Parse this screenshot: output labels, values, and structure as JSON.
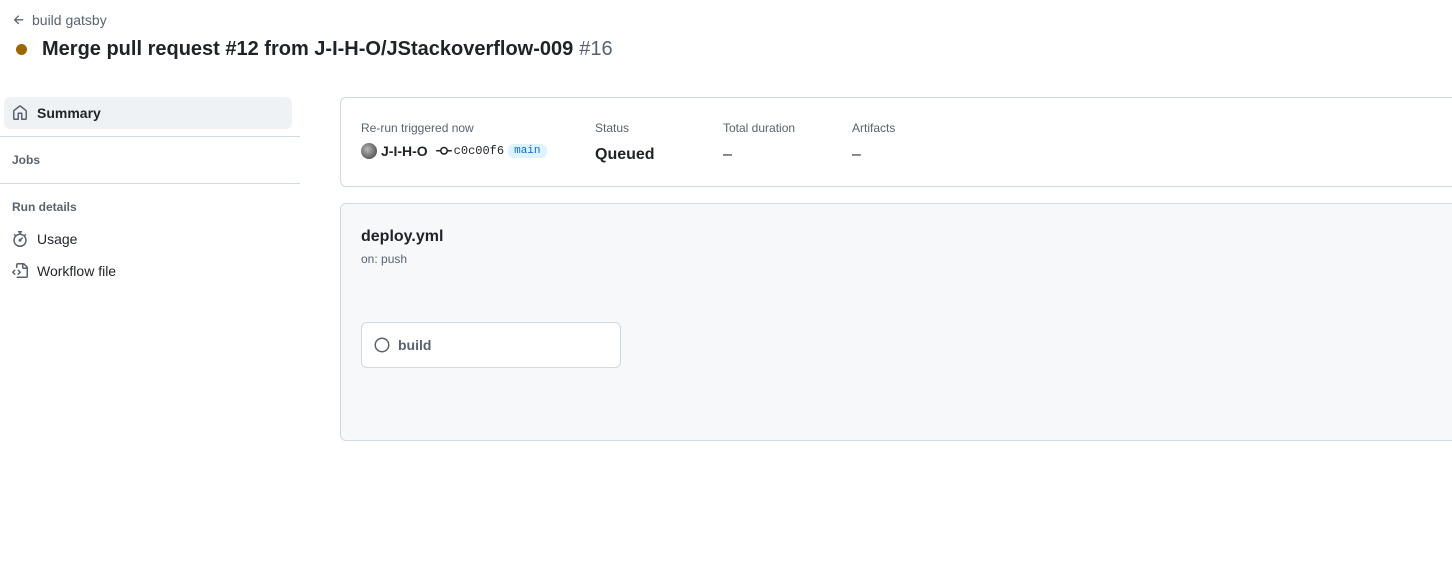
{
  "header": {
    "back_label": "build gatsby",
    "run_title": "Merge pull request #12 from J-I-H-O/JStackoverflow-009",
    "run_number": "#16",
    "status_color": "#9a6700"
  },
  "sidebar": {
    "summary_label": "Summary",
    "jobs_heading": "Jobs",
    "run_details_heading": "Run details",
    "items": [
      {
        "label": "Usage",
        "icon": "stopwatch-icon"
      },
      {
        "label": "Workflow file",
        "icon": "file-code-icon"
      }
    ]
  },
  "summary": {
    "trigger_label": "Re-run triggered now",
    "actor": "J-I-H-O",
    "commit_sha": "c0c00f6",
    "branch": "main",
    "status_label": "Status",
    "status_value": "Queued",
    "duration_label": "Total duration",
    "duration_value": "–",
    "artifacts_label": "Artifacts",
    "artifacts_value": "–"
  },
  "workflow": {
    "file_name": "deploy.yml",
    "trigger": "on: push",
    "jobs": [
      {
        "name": "build",
        "status": "queued"
      }
    ]
  }
}
